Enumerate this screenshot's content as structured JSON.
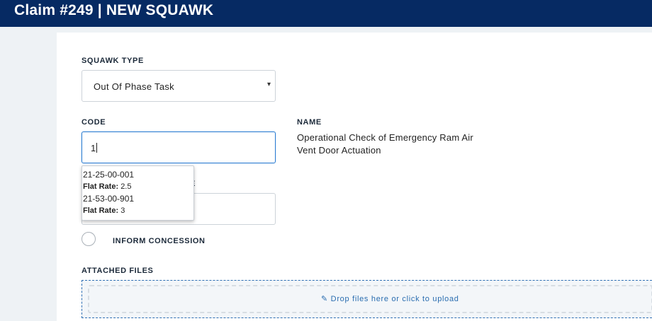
{
  "header": {
    "title": "Claim #249 | NEW SQUAWK"
  },
  "form": {
    "squawk_type_label": "SQUAWK TYPE",
    "squawk_type_value": "Out Of Phase Task",
    "squawk_type_caret": "▾",
    "code_label": "CODE",
    "code_value": "1",
    "name_label": "NAME",
    "name_value": "Operational Check of Emergency Ram Air Vent Door Actuation",
    "occluded_label_tail": "E",
    "inform_concession_label": "INFORM CONCESSION",
    "attached_files_label": "ATTACHED FILES",
    "dropzone_text": "✎ Drop files here or click to upload"
  },
  "suggestions": [
    {
      "code": "21-25-00-001",
      "rate_label": "Flat Rate:",
      "rate_value": "2.5"
    },
    {
      "code": "21-53-00-901",
      "rate_label": "Flat Rate:",
      "rate_value": "3"
    }
  ]
}
